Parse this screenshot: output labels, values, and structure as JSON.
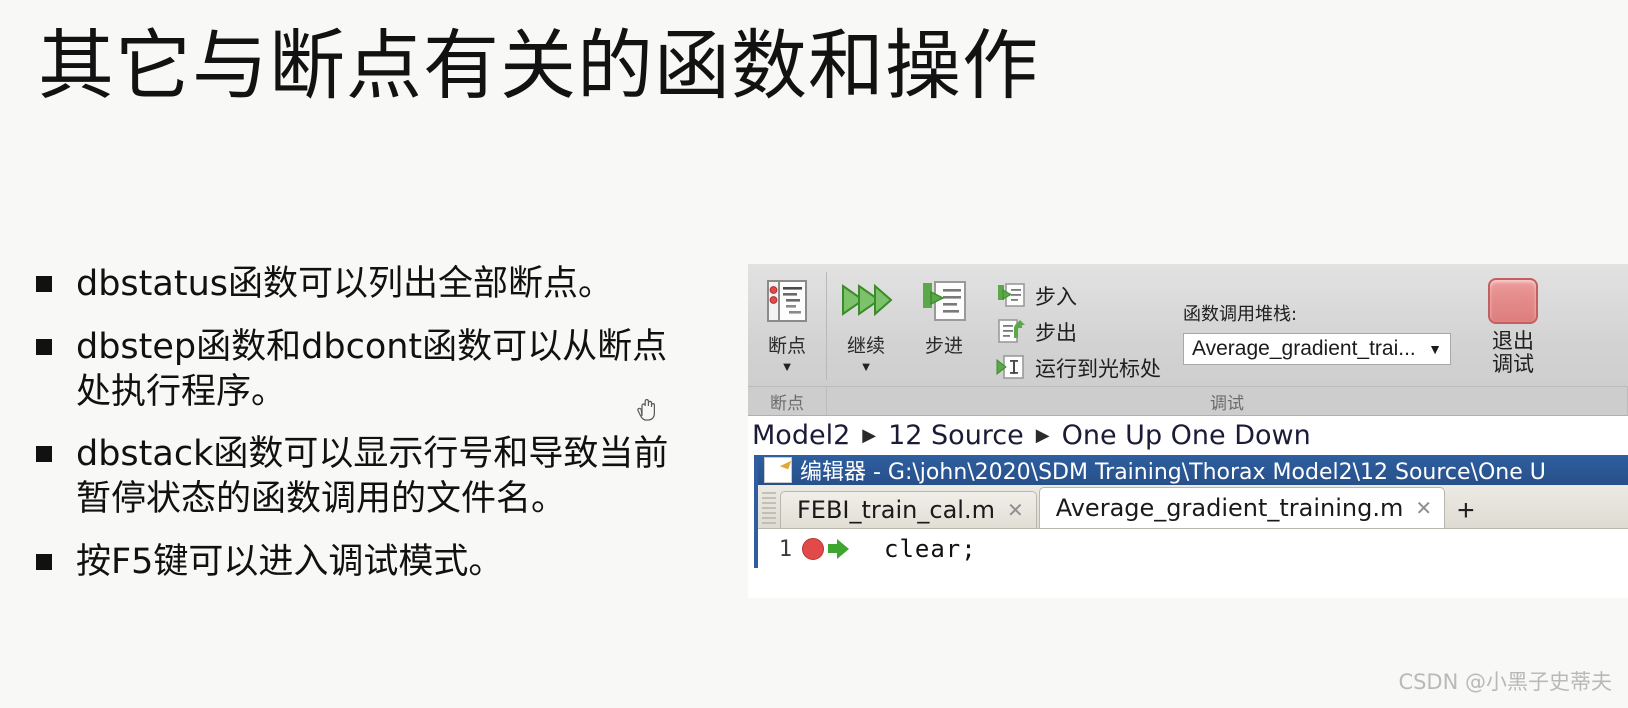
{
  "slide": {
    "title": "其它与断点有关的函数和操作",
    "background_color": "#f8f8f6",
    "bullets": [
      "dbstatus函数可以列出全部断点。",
      "dbstep函数和dbcont函数可以从断点处执行程序。",
      "dbstack函数可以显示行号和导致当前暂停状态的函数调用的文件名。",
      "按F5键可以进入调试模式。"
    ],
    "cursor_glyph": "☞"
  },
  "matlab": {
    "ribbon": {
      "breakpoints_button": {
        "label": "断点",
        "caret": "▼",
        "icon": "breakpoints-icon"
      },
      "continue_button": {
        "label": "继续",
        "caret": "▼",
        "icon": "continue-play-icon"
      },
      "step_button": {
        "label": "步进",
        "icon": "step-over-icon"
      },
      "small_buttons": [
        {
          "label": "步入",
          "icon": "step-in-icon"
        },
        {
          "label": "步出",
          "icon": "step-out-icon"
        },
        {
          "label": "运行到光标处",
          "icon": "run-to-cursor-icon"
        }
      ],
      "call_stack": {
        "label": "函数调用堆栈:",
        "selected": "Average_gradient_trai...",
        "caret": "▼"
      },
      "exit_debug": {
        "label": "退出\n调试",
        "label_line1": "退出",
        "label_line2": "调试",
        "color": "#e08585"
      },
      "group_labels": {
        "breakpoints": "断点",
        "debug": "调试"
      }
    },
    "breadcrumb": {
      "items": [
        "Model2",
        "12 Source",
        "One Up One Down"
      ],
      "separator": "▶"
    },
    "editor": {
      "title": "编辑器 - G:\\john\\2020\\SDM Training\\Thorax Model2\\12 Source\\One U",
      "title_icon": "editor-document-icon",
      "tabs": [
        {
          "label": "FEBI_train_cal.m",
          "close": "✕",
          "active": false
        },
        {
          "label": "Average_gradient_training.m",
          "close": "✕",
          "active": true
        }
      ],
      "add_tab": "+",
      "code_lines": [
        {
          "number": "1",
          "breakpoint": true,
          "run_arrow": true,
          "text": "clear;"
        }
      ]
    }
  },
  "watermark": "CSDN @小黑子史蒂夫"
}
